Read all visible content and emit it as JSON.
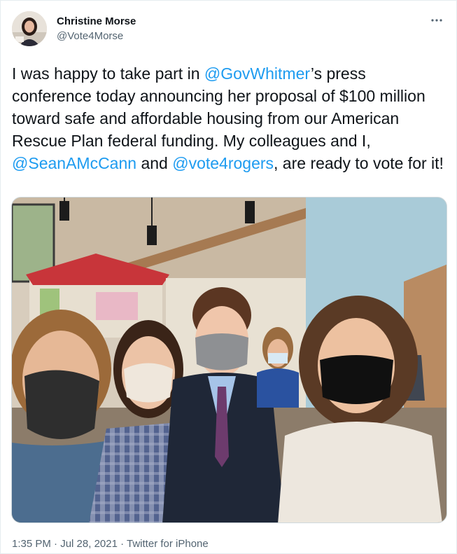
{
  "author": {
    "display_name": "Christine Morse",
    "handle": "@Vote4Morse"
  },
  "tweet": {
    "text_parts": [
      {
        "type": "text",
        "value": "I was happy to take part in "
      },
      {
        "type": "mention",
        "value": "@GovWhitmer"
      },
      {
        "type": "text",
        "value": "’s press conference today announcing her proposal of $100 million toward safe and affordable housing from our American Rescue Plan federal funding. My colleagues and I, "
      },
      {
        "type": "mention",
        "value": "@SeanAMcCann"
      },
      {
        "type": "text",
        "value": " and "
      },
      {
        "type": "mention",
        "value": "@vote4rogers"
      },
      {
        "type": "text",
        "value": ", are ready to vote for it!"
      }
    ]
  },
  "meta": {
    "time": "1:35 PM",
    "separator1": " · ",
    "date": "Jul 28, 2021",
    "separator2": " · ",
    "source": "Twitter for iPhone"
  },
  "icons": {
    "more": "more-horizontal-icon"
  },
  "colors": {
    "mention": "#1d9bf0",
    "secondary_text": "#536471",
    "primary_text": "#0f1419"
  }
}
